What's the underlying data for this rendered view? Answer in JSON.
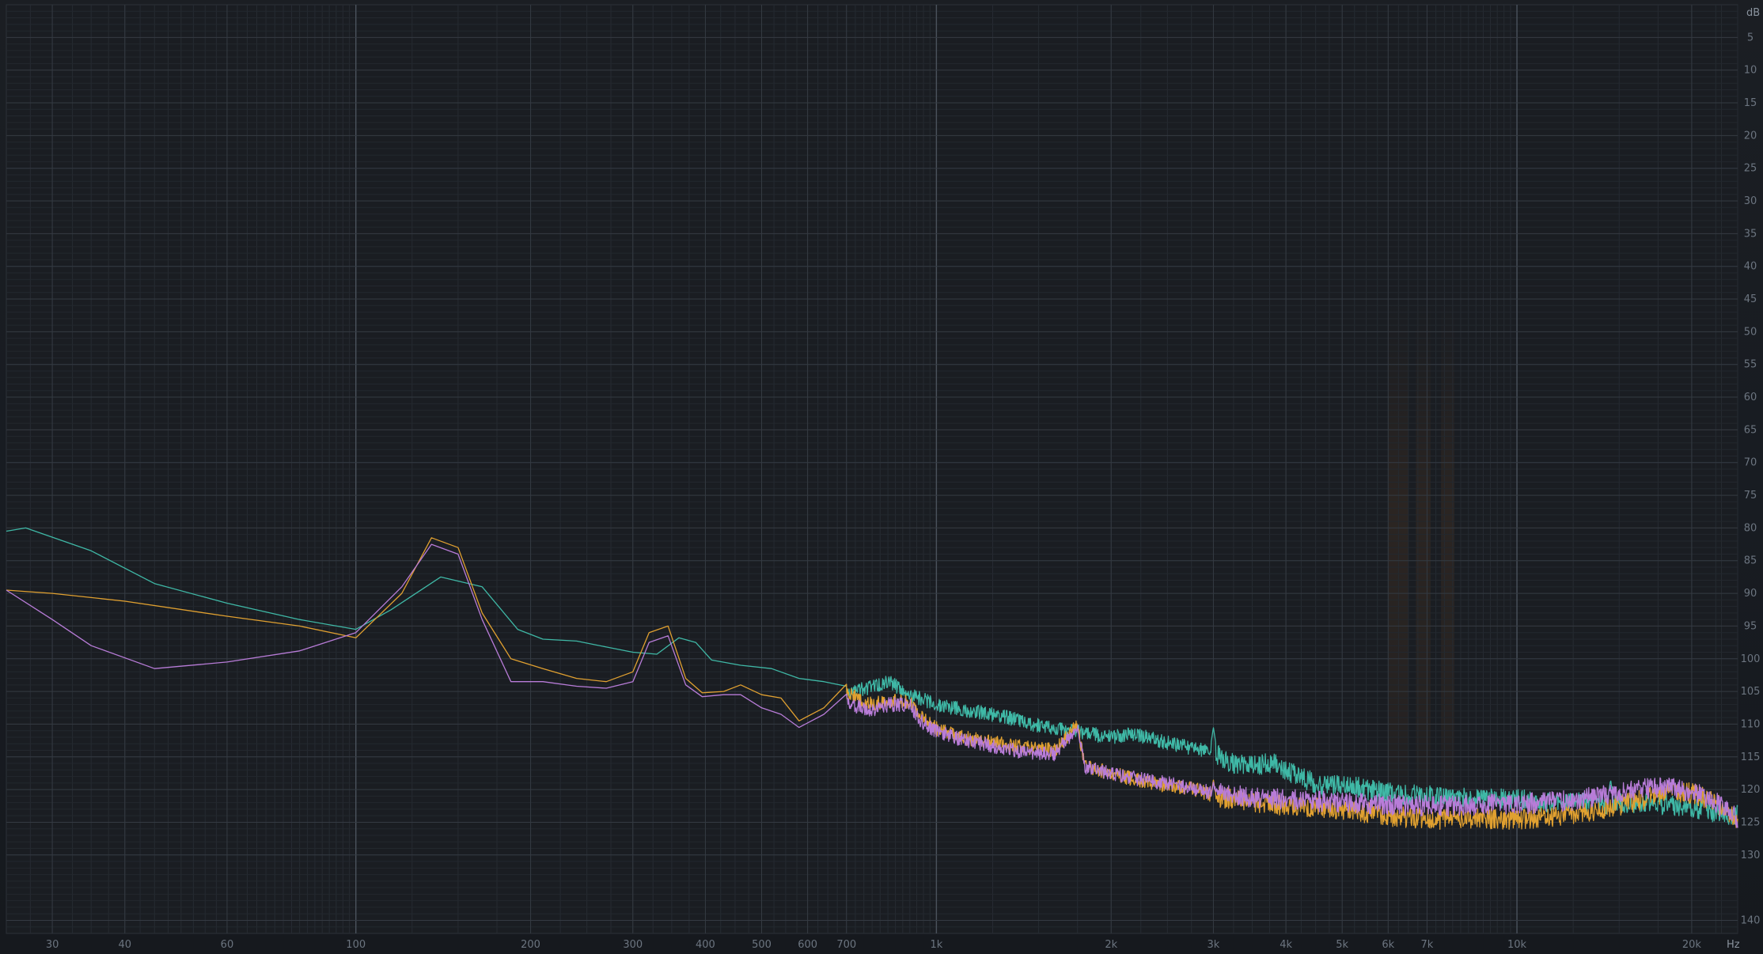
{
  "chart_data": {
    "type": "line",
    "title": "",
    "x_unit": "Hz",
    "y_unit": "dB",
    "x_scale": "log",
    "xlim": [
      25,
      24000
    ],
    "ylim": [
      0,
      142
    ],
    "y_direction": "down",
    "grid": true,
    "x_tick_labels": [
      {
        "value": 30,
        "label": "30"
      },
      {
        "value": 40,
        "label": "40"
      },
      {
        "value": 60,
        "label": "60"
      },
      {
        "value": 100,
        "label": "100"
      },
      {
        "value": 200,
        "label": "200"
      },
      {
        "value": 300,
        "label": "300"
      },
      {
        "value": 400,
        "label": "400"
      },
      {
        "value": 500,
        "label": "500"
      },
      {
        "value": 600,
        "label": "600"
      },
      {
        "value": 700,
        "label": "700"
      },
      {
        "value": 1000,
        "label": "1k"
      },
      {
        "value": 2000,
        "label": "2k"
      },
      {
        "value": 3000,
        "label": "3k"
      },
      {
        "value": 4000,
        "label": "4k"
      },
      {
        "value": 5000,
        "label": "5k"
      },
      {
        "value": 6000,
        "label": "6k"
      },
      {
        "value": 7000,
        "label": "7k"
      },
      {
        "value": 10000,
        "label": "10k"
      },
      {
        "value": 20000,
        "label": "20k"
      }
    ],
    "y_ticks": [
      5,
      10,
      15,
      20,
      25,
      30,
      35,
      40,
      45,
      50,
      55,
      60,
      65,
      70,
      75,
      80,
      85,
      90,
      95,
      100,
      105,
      110,
      115,
      120,
      125,
      130,
      140
    ],
    "series": [
      {
        "color": "#3fb8a6",
        "points": [
          [
            25,
            80.5
          ],
          [
            27,
            80
          ],
          [
            35,
            83.5
          ],
          [
            45,
            88.5
          ],
          [
            60,
            91.5
          ],
          [
            80,
            94
          ],
          [
            100,
            95.5
          ],
          [
            115,
            92.5
          ],
          [
            140,
            87.5
          ],
          [
            165,
            89
          ],
          [
            190,
            95.5
          ],
          [
            210,
            97
          ],
          [
            240,
            97.3
          ],
          [
            270,
            98.2
          ],
          [
            300,
            99
          ],
          [
            330,
            99.3
          ],
          [
            360,
            96.8
          ],
          [
            385,
            97.5
          ],
          [
            410,
            100.2
          ],
          [
            460,
            101
          ],
          [
            520,
            101.5
          ],
          [
            580,
            103
          ],
          [
            640,
            103.5
          ],
          [
            700,
            105.3
          ],
          [
            760,
            104.5
          ],
          [
            830,
            103.5
          ],
          [
            900,
            105.5
          ],
          [
            1000,
            107
          ],
          [
            1150,
            108
          ],
          [
            1300,
            108.8
          ],
          [
            1500,
            110.2
          ],
          [
            1700,
            111
          ],
          [
            2000,
            112
          ],
          [
            2200,
            111.5
          ],
          [
            2400,
            112.5
          ],
          [
            2700,
            113.5
          ],
          [
            3000,
            114.3
          ],
          [
            3200,
            116
          ],
          [
            3500,
            116.3
          ],
          [
            3800,
            115.8
          ],
          [
            4000,
            117
          ],
          [
            4300,
            118.3
          ],
          [
            4600,
            119.5
          ],
          [
            5000,
            119
          ],
          [
            5500,
            120
          ],
          [
            6000,
            120.5
          ],
          [
            7000,
            121
          ],
          [
            8000,
            121.3
          ],
          [
            9000,
            121.5
          ],
          [
            10000,
            121.5
          ],
          [
            12000,
            122
          ],
          [
            14000,
            122.2
          ],
          [
            16000,
            122
          ],
          [
            18000,
            122.3
          ],
          [
            20000,
            122.8
          ],
          [
            22000,
            123.5
          ],
          [
            24000,
            124
          ]
        ],
        "peaks": [
          [
            1000,
            107
          ],
          [
            1750,
            110.2
          ],
          [
            2600,
            115
          ],
          [
            3000,
            110.5
          ],
          [
            14500,
            118.5
          ],
          [
            21000,
            120.5
          ]
        ]
      },
      {
        "color": "#e0a030",
        "points": [
          [
            25,
            89.5
          ],
          [
            30,
            90
          ],
          [
            40,
            91.2
          ],
          [
            60,
            93.5
          ],
          [
            80,
            95
          ],
          [
            100,
            96.8
          ],
          [
            120,
            90
          ],
          [
            135,
            81.5
          ],
          [
            150,
            83
          ],
          [
            165,
            93
          ],
          [
            185,
            100
          ],
          [
            210,
            101.5
          ],
          [
            240,
            103
          ],
          [
            270,
            103.5
          ],
          [
            300,
            102
          ],
          [
            320,
            96
          ],
          [
            345,
            95
          ],
          [
            370,
            103
          ],
          [
            395,
            105.2
          ],
          [
            430,
            105
          ],
          [
            460,
            104
          ],
          [
            500,
            105.5
          ],
          [
            540,
            106
          ],
          [
            580,
            109.5
          ],
          [
            640,
            107.5
          ],
          [
            700,
            105
          ],
          [
            760,
            107
          ],
          [
            830,
            106.5
          ],
          [
            900,
            106.5
          ],
          [
            950,
            109
          ],
          [
            1000,
            110.7
          ],
          [
            1100,
            112
          ],
          [
            1200,
            112.5
          ],
          [
            1400,
            113.5
          ],
          [
            1600,
            114
          ],
          [
            1750,
            110.2
          ],
          [
            1800,
            116.5
          ],
          [
            2000,
            117.5
          ],
          [
            2200,
            118.5
          ],
          [
            2500,
            119.5
          ],
          [
            2800,
            120
          ],
          [
            3000,
            121
          ],
          [
            3300,
            121.5
          ],
          [
            4000,
            122.5
          ],
          [
            5000,
            123
          ],
          [
            6000,
            124
          ],
          [
            7000,
            124.5
          ],
          [
            8000,
            124.5
          ],
          [
            9000,
            124.5
          ],
          [
            10000,
            124.5
          ],
          [
            12000,
            124
          ],
          [
            14000,
            123
          ],
          [
            16000,
            121.8
          ],
          [
            18000,
            120.5
          ],
          [
            20000,
            120.5
          ],
          [
            22000,
            122
          ],
          [
            24000,
            124.5
          ]
        ],
        "peaks": [
          [
            1750,
            110.2
          ],
          [
            2600,
            119.5
          ],
          [
            3000,
            118.5
          ]
        ]
      },
      {
        "color": "#b87cd8",
        "points": [
          [
            25,
            89.5
          ],
          [
            30,
            94
          ],
          [
            35,
            98
          ],
          [
            45,
            101.5
          ],
          [
            60,
            100.5
          ],
          [
            80,
            98.8
          ],
          [
            100,
            96
          ],
          [
            120,
            89
          ],
          [
            135,
            82.5
          ],
          [
            150,
            84
          ],
          [
            165,
            94
          ],
          [
            185,
            103.5
          ],
          [
            210,
            103.5
          ],
          [
            240,
            104.2
          ],
          [
            270,
            104.5
          ],
          [
            300,
            103.5
          ],
          [
            320,
            97.5
          ],
          [
            345,
            96.5
          ],
          [
            370,
            104
          ],
          [
            395,
            105.8
          ],
          [
            430,
            105.5
          ],
          [
            460,
            105.5
          ],
          [
            500,
            107.5
          ],
          [
            540,
            108.5
          ],
          [
            580,
            110.5
          ],
          [
            640,
            108.5
          ],
          [
            700,
            106.5
          ],
          [
            760,
            108
          ],
          [
            830,
            107
          ],
          [
            900,
            107
          ],
          [
            950,
            110
          ],
          [
            1000,
            111
          ],
          [
            1100,
            112.3
          ],
          [
            1200,
            113
          ],
          [
            1400,
            114.2
          ],
          [
            1600,
            114.5
          ],
          [
            1750,
            110.5
          ],
          [
            1800,
            116.5
          ],
          [
            2000,
            117.5
          ],
          [
            2200,
            118.3
          ],
          [
            2500,
            119
          ],
          [
            2800,
            120
          ],
          [
            3000,
            120.5
          ],
          [
            3300,
            121
          ],
          [
            4000,
            121.5
          ],
          [
            5000,
            122
          ],
          [
            6000,
            122.3
          ],
          [
            7000,
            122.5
          ],
          [
            8000,
            122.5
          ],
          [
            9000,
            122.3
          ],
          [
            10000,
            122.2
          ],
          [
            12000,
            121.8
          ],
          [
            14000,
            121
          ],
          [
            16000,
            120
          ],
          [
            18000,
            119.5
          ],
          [
            20000,
            120.2
          ],
          [
            22000,
            122
          ],
          [
            24000,
            124.5
          ]
        ],
        "peaks": [
          [
            1750,
            110.5
          ],
          [
            2600,
            119
          ],
          [
            3000,
            118.8
          ]
        ]
      }
    ]
  }
}
